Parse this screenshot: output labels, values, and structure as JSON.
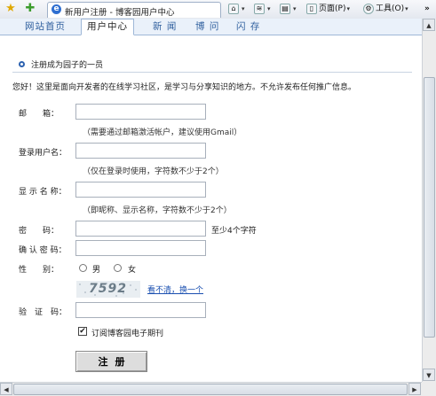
{
  "browser": {
    "tab_title": "新用户注册 - 博客园用户中心",
    "toolbar": {
      "page_label": "页面(P)",
      "tools_label": "工具(O)",
      "more": "»"
    }
  },
  "nav": {
    "items": [
      {
        "label": "网站首页"
      },
      {
        "label": "用户中心"
      },
      {
        "label": "新 闻"
      },
      {
        "label": "博 问"
      },
      {
        "label": "闪 存"
      }
    ]
  },
  "section_title": "注册成为园子的一员",
  "intro": "您好！这里是面向开发者的在线学习社区，是学习与分享知识的地方。不允许发布任何推广信息。",
  "form": {
    "email_label": "邮　　箱：",
    "email_hint": "（需要通过邮箱激活帐户，建议使用Gmail）",
    "username_label": "登录用户名：",
    "username_hint": "（仅在登录时使用，字符数不少于2个）",
    "display_label": "显 示 名 称：",
    "display_hint": "（即昵称、显示名称，字符数不少于2个）",
    "password_label": "密　　码：",
    "password_hint": "至少4个字符",
    "confirm_label": "确 认 密 码：",
    "gender_label": "性　　别：",
    "gender_male": "男",
    "gender_female": "女",
    "captcha_text": "7592",
    "captcha_refresh": "看不清，换一个",
    "verify_label": "验　证　码：",
    "subscribe_label": "订阅博客园电子期刊",
    "subscribe_checked": true,
    "submit_label": "注册"
  },
  "colors": {
    "nav_bg": "#eaf1fa",
    "nav_text": "#2f5f9e",
    "link": "#1a4fb0"
  }
}
